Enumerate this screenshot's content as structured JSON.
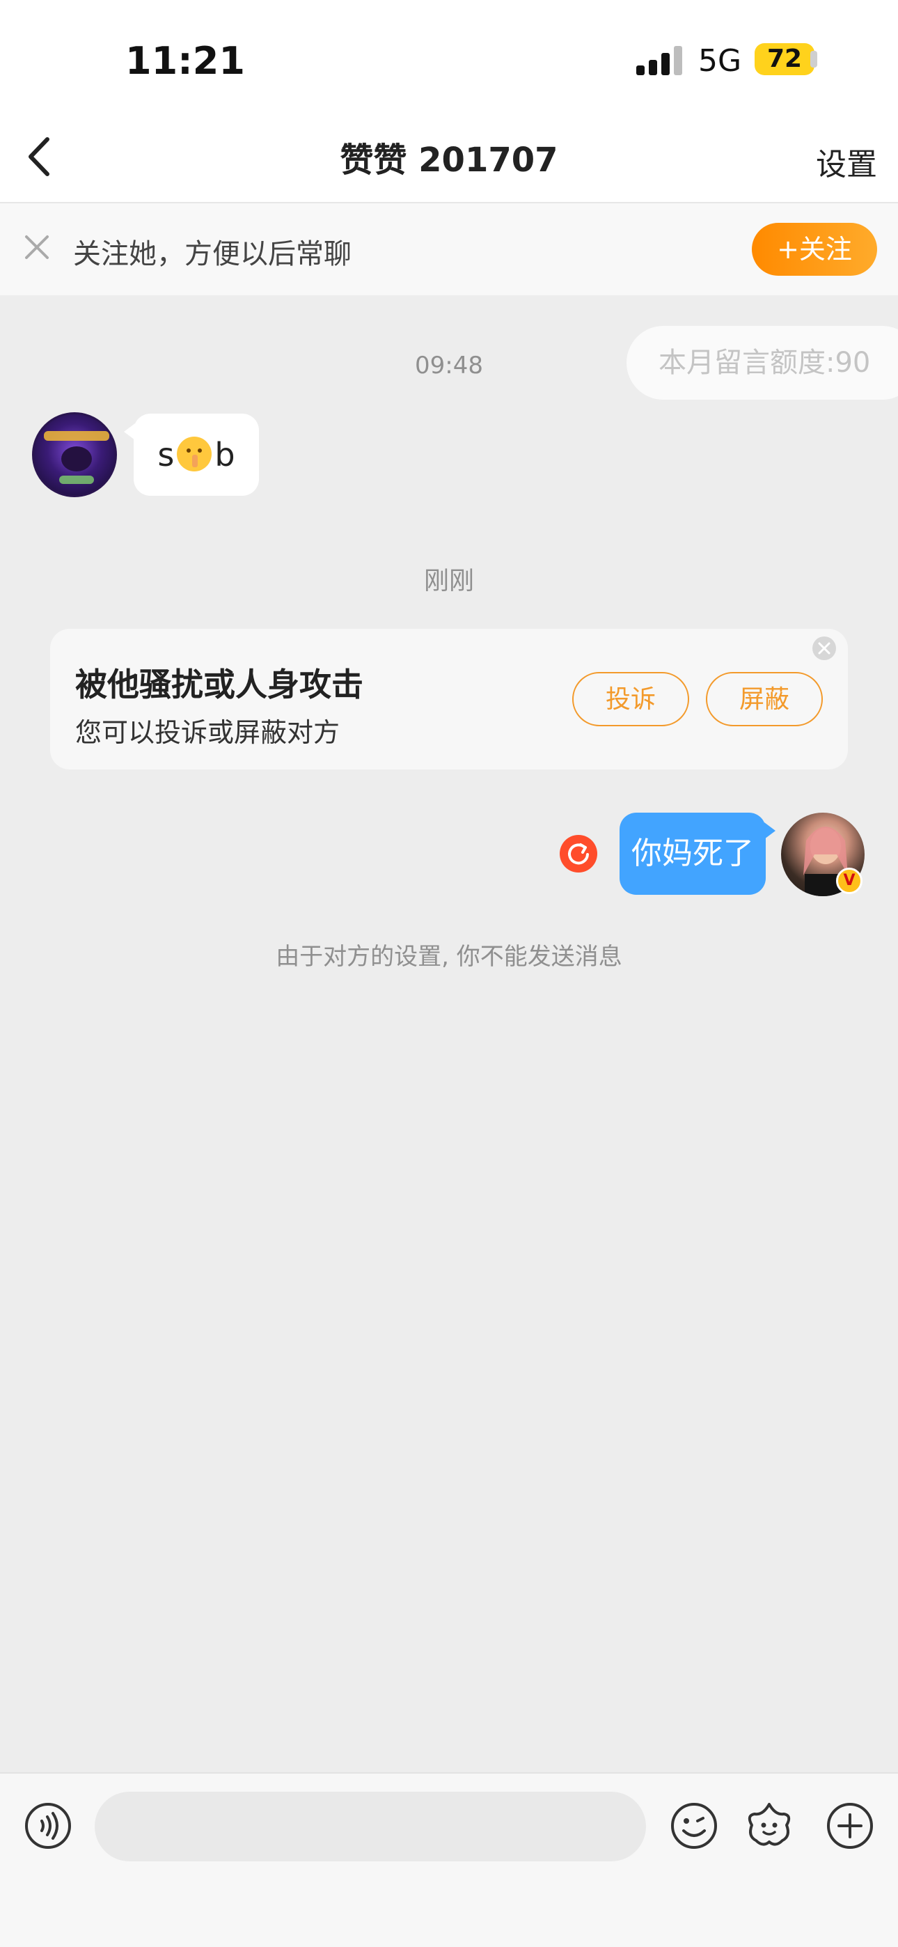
{
  "status_bar": {
    "time": "11:21",
    "network": "5G",
    "battery": "72"
  },
  "nav": {
    "title": "赞赞 201707",
    "settings_label": "设置"
  },
  "follow_bar": {
    "text": "关注她，方便以后常聊",
    "button_label": "+关注"
  },
  "chat": {
    "quota_chip": "本月留言额度:90",
    "timestamp_1": "09:48",
    "incoming_message": {
      "prefix": "s",
      "suffix": "b"
    },
    "timestamp_2": "刚刚",
    "harassment_card": {
      "title": "被他骚扰或人身攻击",
      "subtitle": "您可以投诉或屏蔽对方",
      "report_label": "投诉",
      "block_label": "屏蔽"
    },
    "outgoing_message": {
      "text": "你妈死了"
    },
    "system_note": "由于对方的设置, 你不能发送消息"
  },
  "input_bar": {
    "placeholder": ""
  },
  "colors": {
    "accent_orange": "#ff8a00",
    "bubble_blue": "#42a4ff",
    "retry_red": "#ff4d2b",
    "background": "#ededed"
  },
  "icons": [
    "back-chevron-icon",
    "close-icon",
    "retry-icon",
    "voice-icon",
    "emoji-icon",
    "sticker-icon",
    "plus-icon",
    "verified-badge-icon"
  ]
}
